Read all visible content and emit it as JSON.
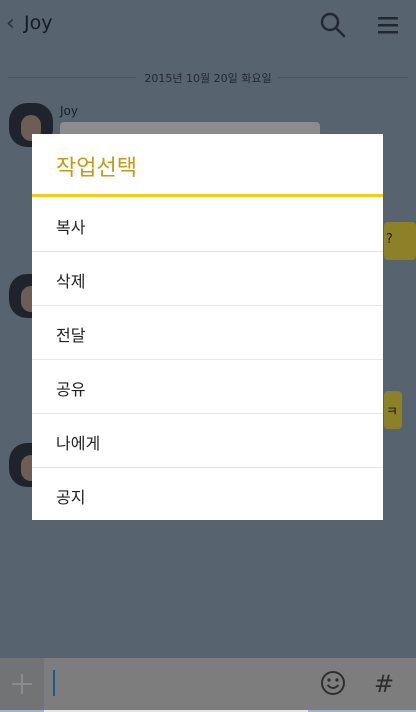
{
  "header": {
    "title": "Joy",
    "subtitle": "",
    "back_icon": "chevron-left-icon",
    "search_icon": "search-icon",
    "menu_icon": "hamburger-menu-icon"
  },
  "chat": {
    "date_divider": "2015년 10월 20일 화요일",
    "sender_name": "Joy",
    "out_snippet_1": "?",
    "out_snippet_2": "ㅋ"
  },
  "dialog": {
    "title": "작업선택",
    "options": [
      "복사",
      "삭제",
      "전달",
      "공유",
      "나에게",
      "공지"
    ],
    "accent_color": "#f2cc1d",
    "title_color": "#c29b17"
  },
  "inputbar": {
    "plus_icon": "plus-icon",
    "emoji_icon": "smiley-icon",
    "hash_label": "#"
  }
}
